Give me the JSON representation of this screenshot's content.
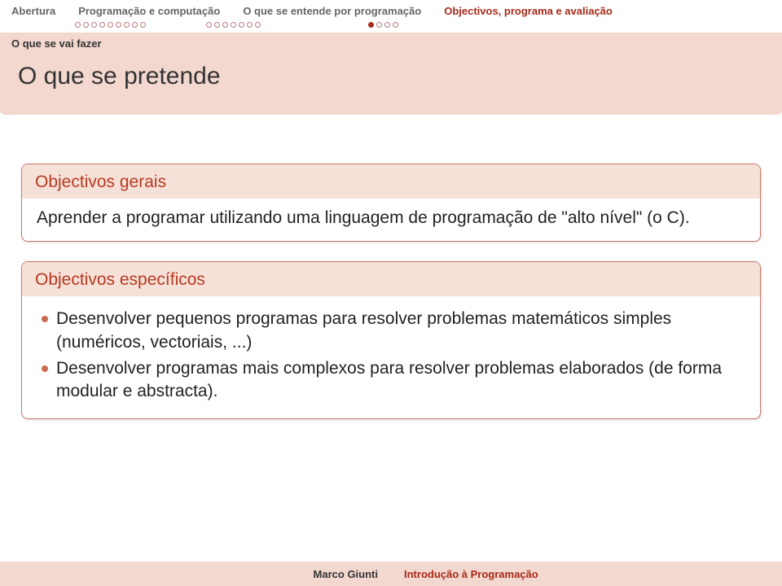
{
  "nav": {
    "items": [
      {
        "label": "Abertura",
        "active": false,
        "dots": 0,
        "filled": 0
      },
      {
        "label": "Programação e computação",
        "active": false,
        "dots": 9,
        "filled": 0
      },
      {
        "label": "O que se entende por programação",
        "active": false,
        "dots": 7,
        "filled": 0
      },
      {
        "label": "Objectivos, programa e avaliação",
        "active": true,
        "dots": 4,
        "filled": 1
      }
    ]
  },
  "subsection": "O que se vai fazer",
  "frame_title": "O que se pretende",
  "block1": {
    "title": "Objectivos gerais",
    "body": "Aprender a programar utilizando uma linguagem de programação de \"alto nível\" (o C)."
  },
  "block2": {
    "title": "Objectivos específicos",
    "items": [
      "Desenvolver pequenos programas para resolver problemas matemáticos simples (numéricos, vectoriais, ...)",
      "Desenvolver programas mais complexos para resolver problemas elaborados (de forma modular e abstracta)."
    ]
  },
  "footer": {
    "author": "Marco Giunti",
    "title": "Introdução à Programação"
  }
}
